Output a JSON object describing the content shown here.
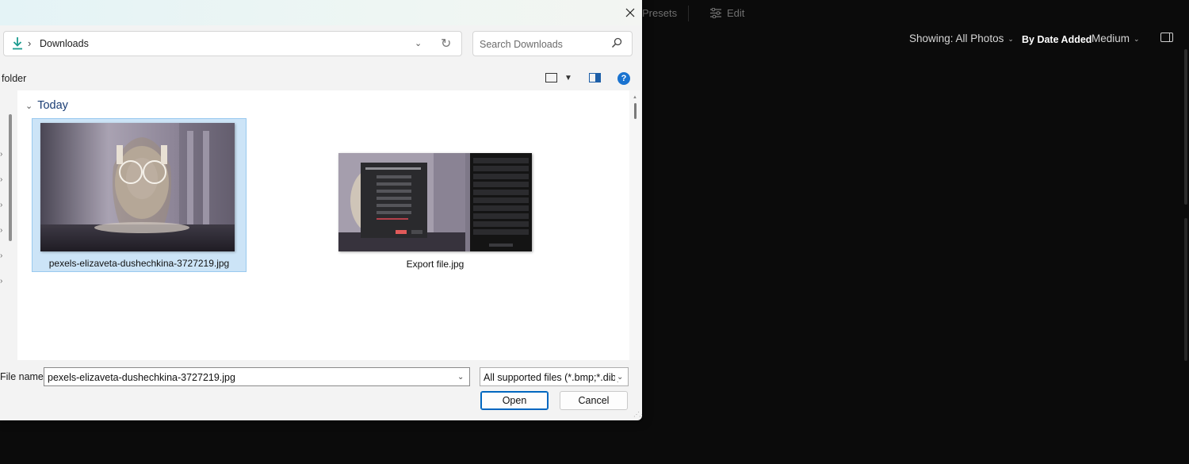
{
  "background_app": {
    "toolbar": {
      "presets_label": "Presets",
      "edit_label": "Edit"
    },
    "filters": {
      "showing_label": "Showing: All Photos",
      "sort_label": "By Date Added",
      "size_label": "Medium"
    }
  },
  "dialog": {
    "address": {
      "path": "Downloads"
    },
    "search": {
      "placeholder": "Search Downloads"
    },
    "command_bar": {
      "new_folder_label": "folder"
    },
    "group": {
      "label": "Today"
    },
    "files": [
      {
        "name": "pexels-elizaveta-dushechkina-3727219.jpg",
        "selected": true
      },
      {
        "name": "Export file.jpg",
        "selected": false
      }
    ],
    "file_name": {
      "label": "File name:",
      "value": "pexels-elizaveta-dushechkina-3727219.jpg"
    },
    "file_type": {
      "value": "All supported files (*.bmp;*.dib;"
    },
    "buttons": {
      "open": "Open",
      "cancel": "Cancel"
    },
    "help_glyph": "?"
  },
  "colors": {
    "app_background": "#0b0b0b",
    "dialog_background": "#f3f3f3",
    "selection_fill": "#cce4f7",
    "selection_border": "#99c9ef",
    "accent": "#0067c0"
  }
}
